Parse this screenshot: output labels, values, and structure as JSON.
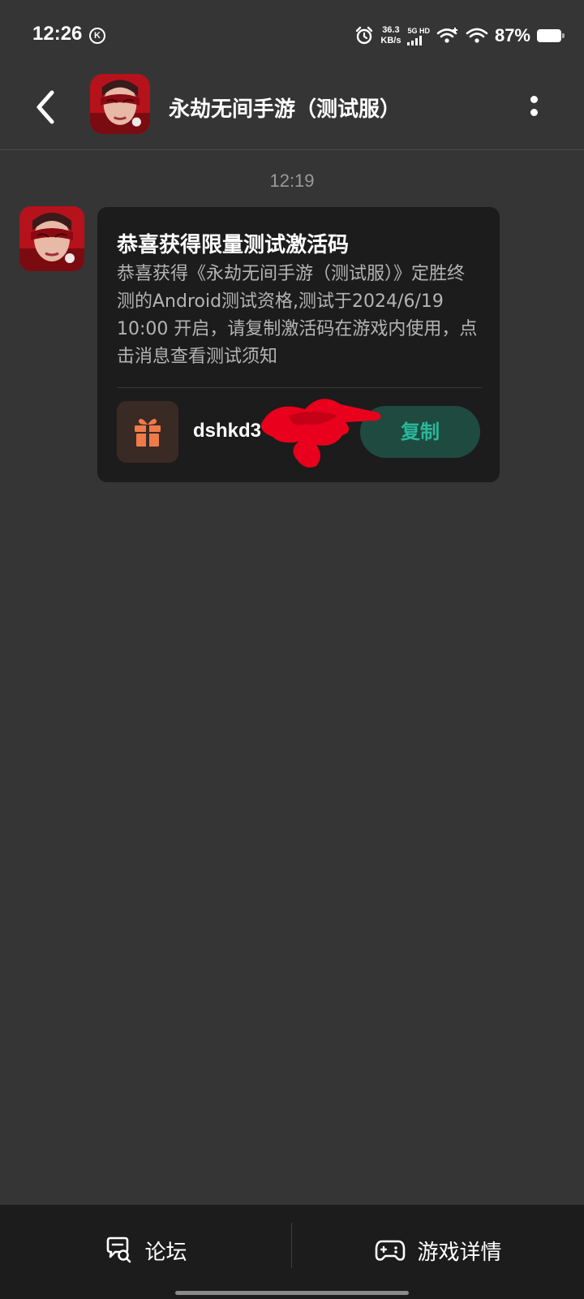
{
  "status_bar": {
    "time": "12:26",
    "k_badge": "K",
    "speed_value": "36.3",
    "speed_unit": "KB/s",
    "network": "5G HD",
    "battery": "87%"
  },
  "header": {
    "title": "永劫无间手游（测试服）",
    "back_icon": "back-arrow-icon",
    "more_icon": "more-vertical-icon"
  },
  "chat": {
    "timestamp": "12:19",
    "card": {
      "title": "恭喜获得限量测试激活码",
      "body": "恭喜获得《永劫无间手游（测试服）》定胜终测的Android测试资格,测试于2024/6/19 10:00 开启，请复制激活码在游戏内使用，点击消息查看测试须知",
      "code": "dshkd3",
      "copy_label": "复制",
      "gift_icon": "gift-icon"
    }
  },
  "bottom_nav": {
    "forum_label": "论坛",
    "forum_icon": "chat-search-icon",
    "details_label": "游戏详情",
    "details_icon": "gamepad-icon"
  },
  "colors": {
    "background": "#353535",
    "card": "#1c1c1c",
    "accent": "#2ab79a",
    "gift": "#f07a4a",
    "scribble": "#e8001c"
  }
}
